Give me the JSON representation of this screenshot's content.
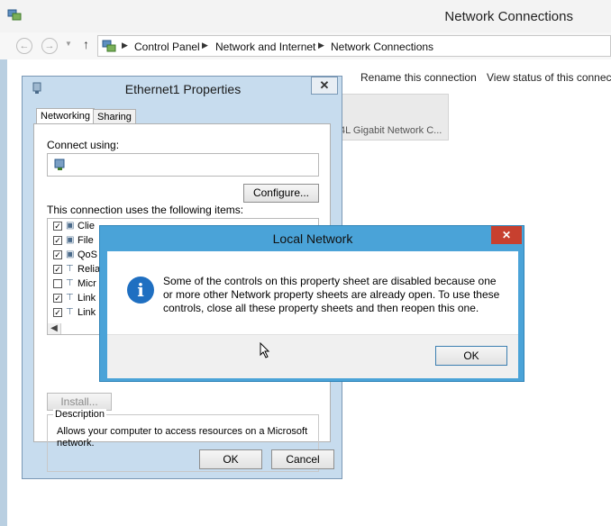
{
  "main": {
    "title": "Network Connections",
    "breadcrumb": [
      "Control Panel",
      "Network and Internet",
      "Network Connections"
    ],
    "commands": [
      "Rename this connection",
      "View status of this connecti"
    ],
    "adapter_tile_text": "4L Gigabit Network C..."
  },
  "props": {
    "title": "Ethernet1 Properties",
    "tabs": [
      "Networking",
      "Sharing"
    ],
    "connect_using_label": "Connect using:",
    "configure_label": "Configure...",
    "items_label": "This connection uses the following items:",
    "items": [
      {
        "label": "Clie",
        "checked": true
      },
      {
        "label": "File",
        "checked": true
      },
      {
        "label": "QoS",
        "checked": true
      },
      {
        "label": "Relia",
        "checked": true
      },
      {
        "label": "Micr",
        "checked": false
      },
      {
        "label": "Link",
        "checked": true
      },
      {
        "label": "Link",
        "checked": true
      }
    ],
    "install_label": "Install...",
    "description_legend": "Description",
    "description_text": "Allows your computer to access resources on a Microsoft network.",
    "ok_label": "OK",
    "cancel_label": "Cancel"
  },
  "msg": {
    "title": "Local Network",
    "text": "Some of the controls on this property sheet are disabled because one or more other Network property sheets are already open.  To use these controls, close all these property sheets and then reopen this one.",
    "ok_label": "OK",
    "icon": "info-icon"
  },
  "colors": {
    "accent": "#4aa3d8",
    "close_red": "#c7402f",
    "dialog_frame": "#c7dcee",
    "info_blue": "#1f6fc1"
  }
}
